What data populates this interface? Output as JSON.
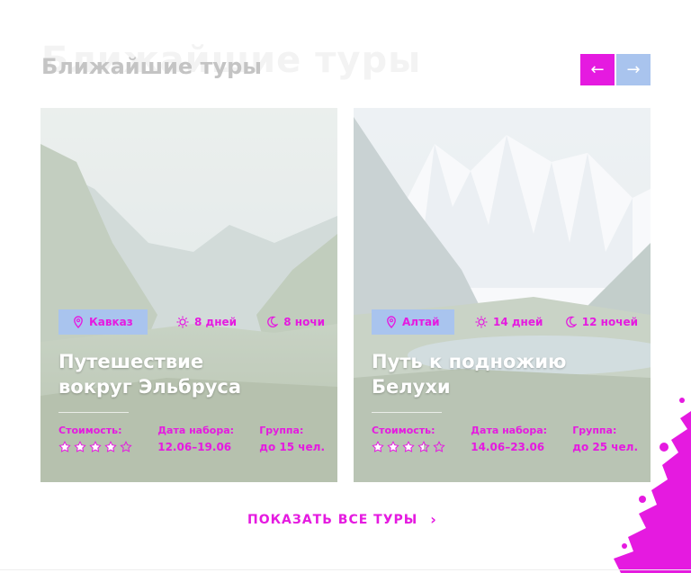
{
  "header": {
    "ghost_title": "Ближайшие туры",
    "title": "Ближайшие туры",
    "prev_arrow": "←",
    "next_arrow": "→"
  },
  "colors": {
    "accent": "#e51ae0",
    "tag_bg": "#a9c4ee",
    "title": "#c4c4c4"
  },
  "tours": [
    {
      "location": "Кавказ",
      "days": "8 дней",
      "nights": "8 ночи",
      "title_line1": "Путешествие",
      "title_line2": "вокруг Эльбруса",
      "price_label": "Стоимость:",
      "rating": 4,
      "date_label": "Дата набора:",
      "date_value": "12.06–19.06",
      "group_label": "Группа:",
      "group_value": "до 15 чел."
    },
    {
      "location": "Алтай",
      "days": "14 дней",
      "nights": "12 ночей",
      "title_line1": "Путь к подножию",
      "title_line2": "Белухи",
      "price_label": "Стоимость:",
      "rating": 3.5,
      "date_label": "Дата набора:",
      "date_value": "14.06–23.06",
      "group_label": "Группа:",
      "group_value": "до 25 чел."
    }
  ],
  "show_all": {
    "label": "ПОКАЗАТЬ ВСЕ ТУРЫ",
    "arrow": "›"
  },
  "icons": [
    "location-pin-icon",
    "sun-icon",
    "moon-icon",
    "star-icon",
    "arrow-left-icon",
    "arrow-right-icon",
    "chevron-right-icon"
  ]
}
